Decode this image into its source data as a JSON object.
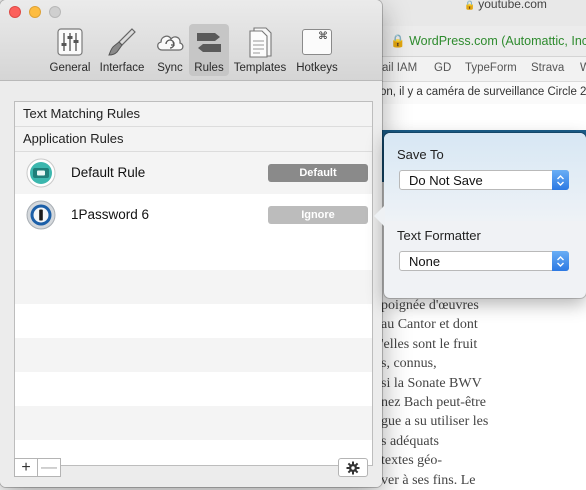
{
  "browser": {
    "url": "youtube.com",
    "secure_site": "WordPress.com (Automattic, Inc.",
    "bookmarks": [
      "ail IAM",
      "GD",
      "TypeForm",
      "Strava",
      "W"
    ],
    "article_headline": "on, il y a caméra de surveillance Circle 2",
    "article_lines": [
      "poignée d'œuvres",
      "au Cantor et dont",
      "'elles sont le fruit",
      "s, connus,",
      "si la Sonate BWV",
      "nez Bach peut-être",
      "gue a su utiliser les",
      "s adéquats",
      "textes géo-",
      "ver à ses fins. Le"
    ]
  },
  "toolbar": {
    "items": [
      {
        "label": "General",
        "icon": "sliders-icon"
      },
      {
        "label": "Interface",
        "icon": "brush-icon"
      },
      {
        "label": "Sync",
        "icon": "cloud-sync-icon"
      },
      {
        "label": "Rules",
        "icon": "rules-icon"
      },
      {
        "label": "Templates",
        "icon": "templates-icon"
      },
      {
        "label": "Hotkeys",
        "icon": "command-key-icon"
      }
    ],
    "selected": "Rules",
    "hotkey_symbol": "⌘"
  },
  "rules": {
    "sections": {
      "text_matching": "Text Matching Rules",
      "application": "Application Rules"
    },
    "rows": [
      {
        "name": "Default Rule",
        "badge": "Default"
      },
      {
        "name": "1Password 6",
        "badge": "Ignore"
      }
    ],
    "add_label": "+",
    "remove_label": "—"
  },
  "popover": {
    "save_to_label": "Save To",
    "save_to_value": "Do Not Save",
    "formatter_label": "Text Formatter",
    "formatter_value": "None"
  },
  "colors": {
    "accent_blue": "#2c79e3",
    "close_red": "#fc605c",
    "minimize_yellow": "#fdbc40",
    "default_badge": "#8a8a8a",
    "ignore_badge": "#bcbcbc",
    "secure_green": "#2e8b2e"
  }
}
